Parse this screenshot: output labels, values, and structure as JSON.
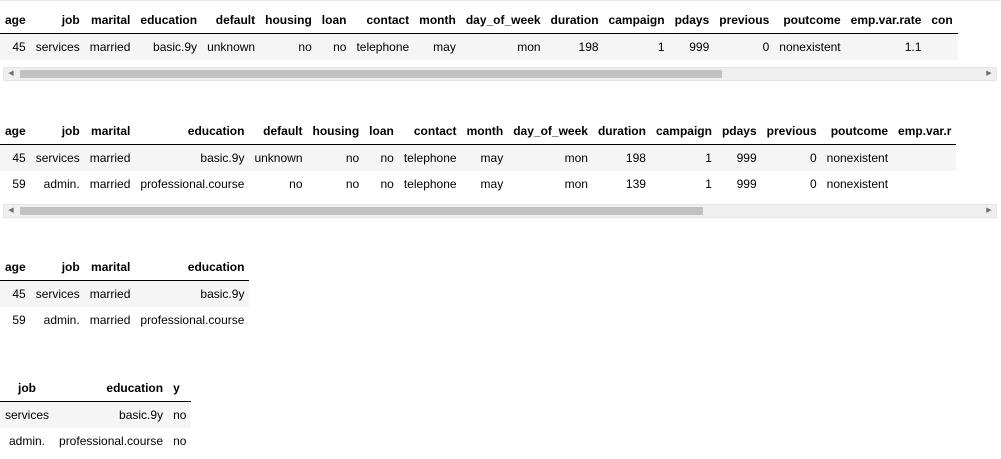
{
  "tables": [
    {
      "columns": [
        "age",
        "job",
        "marital",
        "education",
        "default",
        "housing",
        "loan",
        "contact",
        "month",
        "day_of_week",
        "duration",
        "campaign",
        "pdays",
        "previous",
        "poutcome",
        "emp.var.rate",
        "con"
      ],
      "align": [
        "r",
        "r",
        "r",
        "r",
        "r",
        "r",
        "r",
        "r",
        "r",
        "r",
        "r",
        "r",
        "r",
        "r",
        "r",
        "r",
        "r"
      ],
      "rows": [
        [
          "45",
          "services",
          "married",
          "basic.9y",
          "unknown",
          "no",
          "no",
          "telephone",
          "may",
          "mon",
          "198",
          "1",
          "999",
          "0",
          "nonexistent",
          "1.1",
          ""
        ]
      ],
      "scroll": {
        "left_arrow": "◀",
        "right_arrow": "▶",
        "fraction": 0.73
      }
    },
    {
      "columns": [
        "age",
        "job",
        "marital",
        "education",
        "default",
        "housing",
        "loan",
        "contact",
        "month",
        "day_of_week",
        "duration",
        "campaign",
        "pdays",
        "previous",
        "poutcome",
        "emp.var.r"
      ],
      "align": [
        "r",
        "r",
        "r",
        "r",
        "r",
        "r",
        "r",
        "r",
        "r",
        "r",
        "r",
        "r",
        "r",
        "r",
        "r",
        "r"
      ],
      "rows": [
        [
          "45",
          "services",
          "married",
          "basic.9y",
          "unknown",
          "no",
          "no",
          "telephone",
          "may",
          "mon",
          "198",
          "1",
          "999",
          "0",
          "nonexistent",
          ""
        ],
        [
          "59",
          "admin.",
          "married",
          "professional.course",
          "no",
          "no",
          "no",
          "telephone",
          "may",
          "mon",
          "139",
          "1",
          "999",
          "0",
          "nonexistent",
          ""
        ]
      ],
      "scroll": {
        "left_arrow": "◀",
        "right_arrow": "▶",
        "fraction": 0.71
      }
    },
    {
      "columns": [
        "age",
        "job",
        "marital",
        "education"
      ],
      "align": [
        "r",
        "r",
        "r",
        "r"
      ],
      "rows": [
        [
          "45",
          "services",
          "married",
          "basic.9y"
        ],
        [
          "59",
          "admin.",
          "married",
          "professional.course"
        ]
      ]
    },
    {
      "columns": [
        "job",
        "education",
        "y"
      ],
      "align": [
        "c",
        "r",
        "l"
      ],
      "rows": [
        [
          "services",
          "basic.9y",
          "no"
        ],
        [
          "admin.",
          "professional.course",
          "no"
        ]
      ]
    }
  ]
}
